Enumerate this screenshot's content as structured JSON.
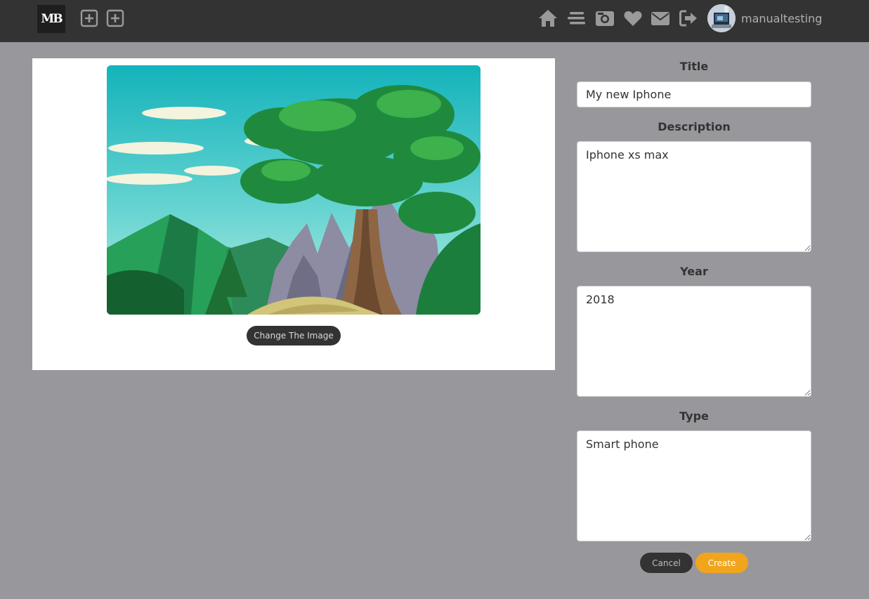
{
  "header": {
    "logo_text": "MB",
    "username": "manualtesting",
    "icons": [
      "add-square-icon",
      "add-square-icon",
      "home-icon",
      "menu-icon",
      "camera-icon",
      "heart-icon",
      "envelope-icon",
      "logout-icon"
    ]
  },
  "image_panel": {
    "change_button": "Change The Image"
  },
  "form": {
    "title_label": "Title",
    "title_value": "My new Iphone",
    "description_label": "Description",
    "description_value": "Iphone xs max",
    "year_label": "Year",
    "year_value": "2018",
    "type_label": "Type",
    "type_value": "Smart phone",
    "cancel_label": "Cancel",
    "create_label": "Create"
  },
  "colors": {
    "header_bg": "#333333",
    "page_bg": "#98979c",
    "accent": "#f0a51c",
    "dark_button": "#333333"
  }
}
